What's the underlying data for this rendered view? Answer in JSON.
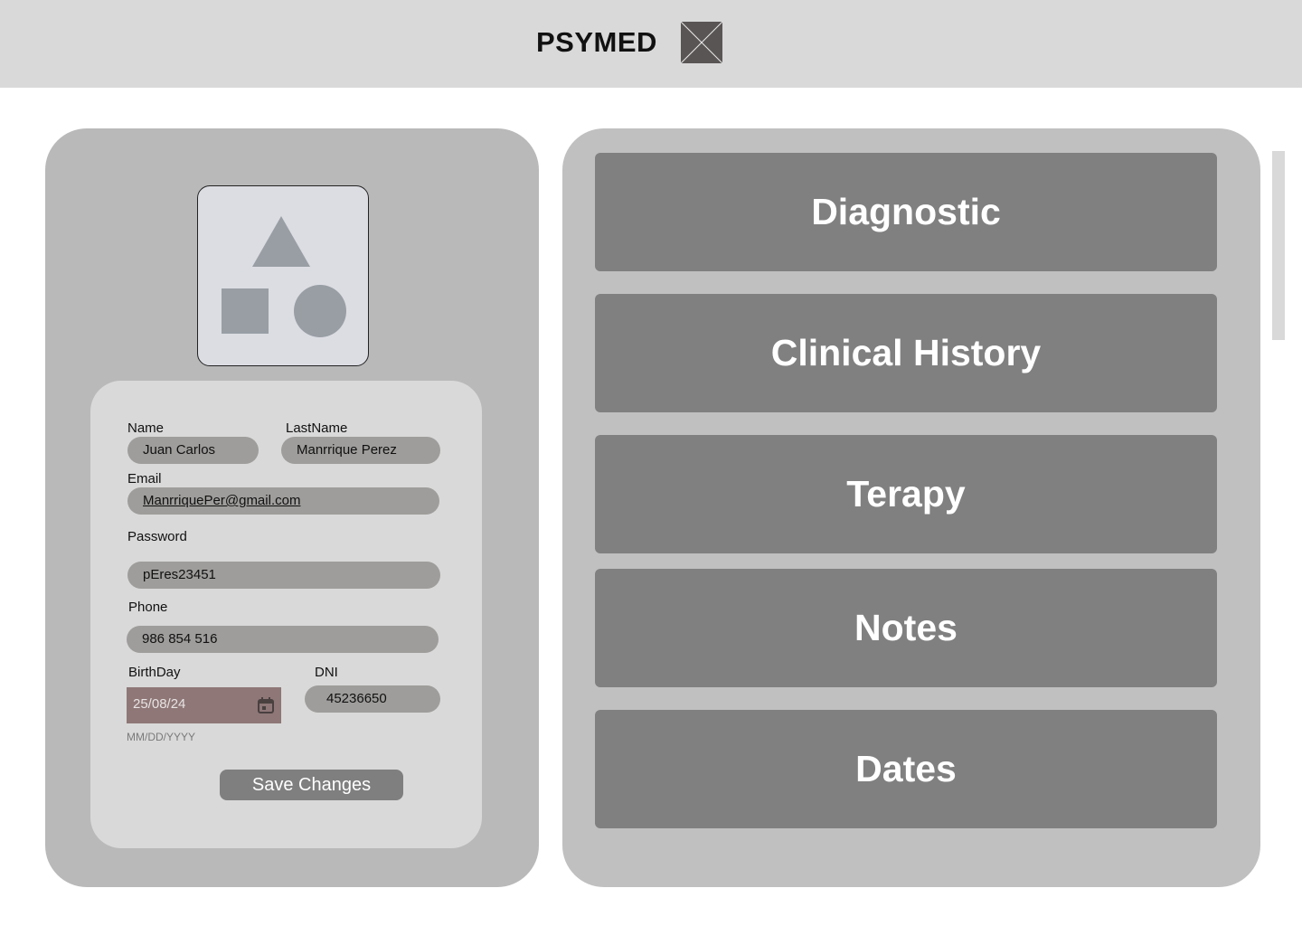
{
  "header": {
    "brand": "PSYMED",
    "logo_icon": "image-placeholder-icon"
  },
  "profile": {
    "avatar_icon": "shapes-placeholder-icon",
    "fields": {
      "name": {
        "label": "Name",
        "value": "Juan Carlos"
      },
      "lastname": {
        "label": "LastName",
        "value": "Manrrique Perez"
      },
      "email": {
        "label": "Email",
        "value": "ManrriquePer@gmail.com"
      },
      "password": {
        "label": "Password",
        "value": "pEres23451"
      },
      "phone": {
        "label": "Phone",
        "value": "986 854 516"
      },
      "birthday": {
        "label": "BirthDay",
        "value": "25/08/24",
        "hint": "MM/DD/YYYY",
        "icon": "calendar-icon"
      },
      "dni": {
        "label": "DNI",
        "value": "45236650"
      }
    },
    "save_label": "Save Changes"
  },
  "menu": {
    "items": [
      {
        "label": "Diagnostic"
      },
      {
        "label": "Clinical History"
      },
      {
        "label": "Terapy"
      },
      {
        "label": "Notes"
      },
      {
        "label": "Dates"
      }
    ]
  },
  "colors": {
    "header_bg": "#d9d9d9",
    "panel_bg": "#b9b9b9",
    "card_bg": "#808080",
    "input_bg": "#9e9d9b",
    "date_bg": "#8f7777"
  }
}
